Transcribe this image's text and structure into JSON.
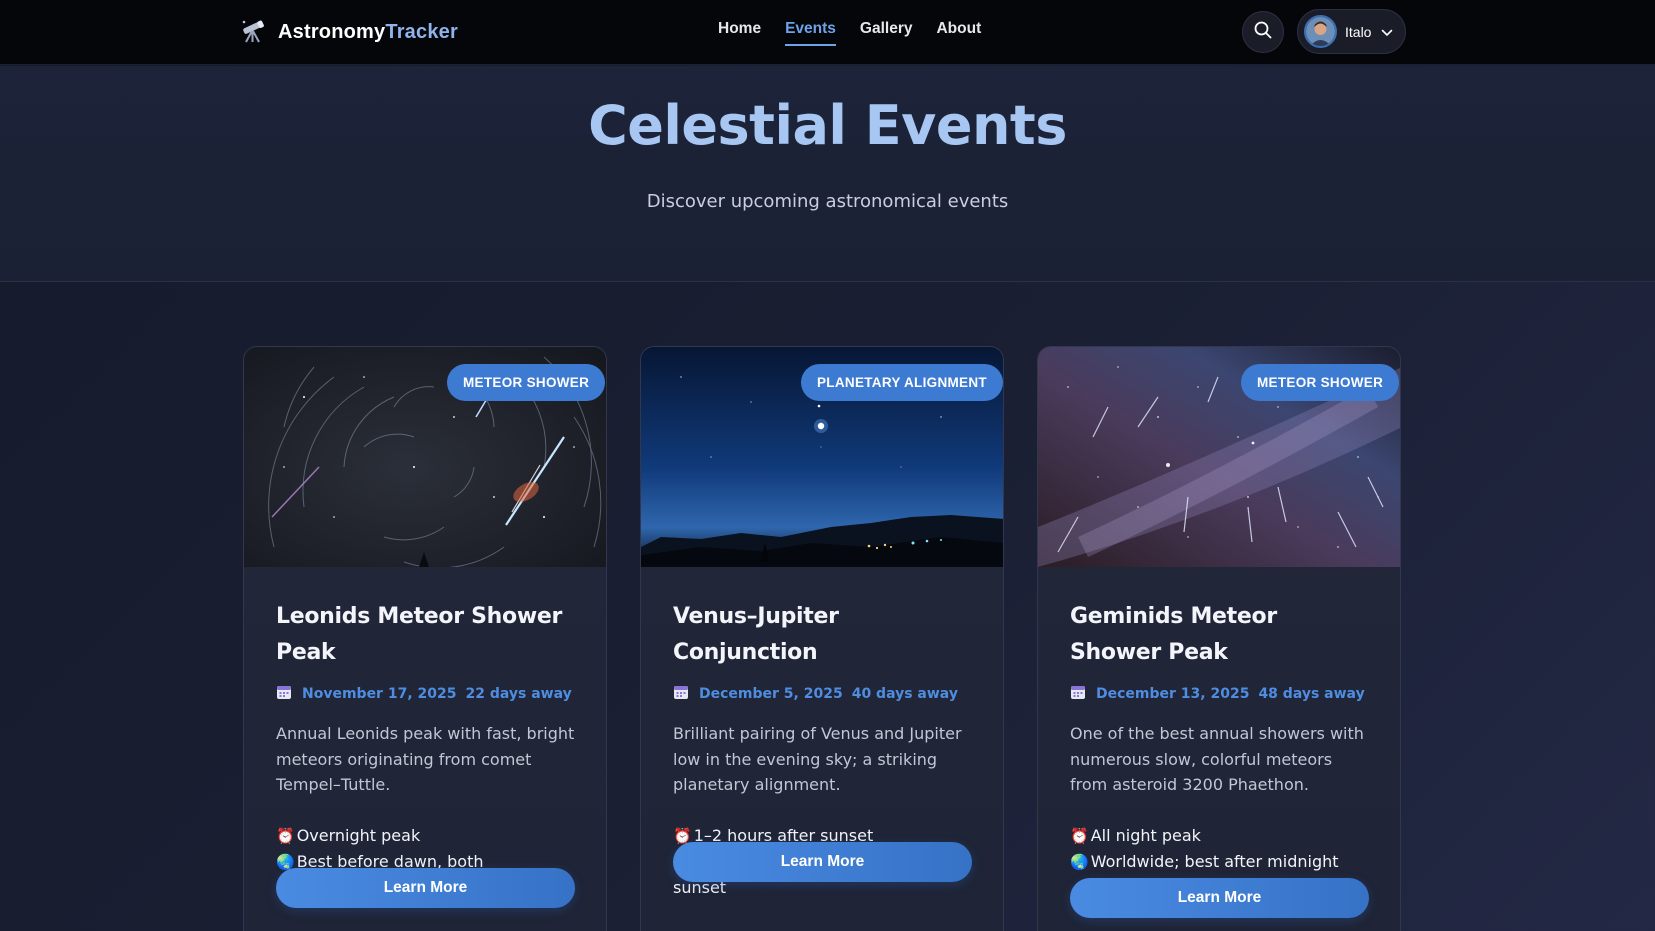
{
  "nav": {
    "brand_main": "Astronomy",
    "brand_accent": "Tracker",
    "links": [
      "Home",
      "Events",
      "Gallery",
      "About"
    ],
    "active_link": "Events",
    "user_name": "Italo"
  },
  "hero": {
    "title": "Celestial Events",
    "subtitle": "Discover upcoming astronomical events"
  },
  "events": [
    {
      "badge": "METEOR SHOWER",
      "title": "Leonids Meteor Shower Peak",
      "date": "November 17, 2025",
      "days_away": "22 days away",
      "description": "Annual Leonids peak with fast, bright meteors originating from comet Tempel–Tuttle.",
      "time_info": "Overnight peak",
      "visibility": "Best before dawn, both hemispheres (dark skies)",
      "button": "Learn More"
    },
    {
      "badge": "PLANETARY ALIGNMENT",
      "title": "Venus–Jupiter Conjunction",
      "date": "December 5, 2025",
      "days_away": "40 days away",
      "description": "Brilliant pairing of Venus and Jupiter low in the evening sky; a striking planetary alignment.",
      "time_info": "1–2 hours after sunset",
      "visibility": "Global, low western sky after sunset",
      "button": "Learn More"
    },
    {
      "badge": "METEOR SHOWER",
      "title": "Geminids Meteor Shower Peak",
      "date": "December 13, 2025",
      "days_away": "48 days away",
      "description": "One of the best annual showers with numerous slow, colorful meteors from asteroid 3200 Phaethon.",
      "time_info": "All night peak",
      "visibility": "Worldwide; best after midnight",
      "button": "Learn More"
    }
  ],
  "icons": {
    "logo": "telescope-icon",
    "search": "search-icon",
    "chevron": "chevron-down-icon",
    "calendar": "calendar-icon",
    "clock": "alarm-clock-icon",
    "globe": "globe-icon"
  },
  "colors": {
    "accent": "#4f8de0",
    "badge": "#3d7ad1",
    "title": "#a7c6f2",
    "navbar": "#05060a"
  }
}
